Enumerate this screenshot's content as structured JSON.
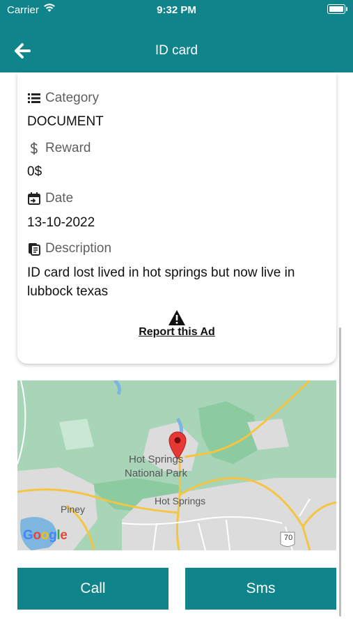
{
  "status": {
    "carrier": "Carrier",
    "time": "9:32 PM"
  },
  "header": {
    "title": "ID card",
    "back_icon": "arrow-left-icon"
  },
  "details": {
    "category": {
      "label": "Category",
      "value": "DOCUMENT",
      "icon": "list-icon"
    },
    "reward": {
      "label": "Reward",
      "value": "0$",
      "icon": "dollar-icon"
    },
    "date": {
      "label": "Date",
      "value": "13-10-2022",
      "icon": "calendar-icon"
    },
    "description": {
      "label": "Description",
      "value": "ID card lost lived in hot springs but now live in lubbock texas",
      "icon": "notes-icon"
    }
  },
  "report": {
    "label": "Report this Ad",
    "icon": "warning-icon"
  },
  "map": {
    "places": [
      "Hot Springs",
      "National Park",
      "Hot Springs",
      "Piney"
    ],
    "shield": "70",
    "attribution": "Google"
  },
  "actions": {
    "call": "Call",
    "sms": "Sms"
  },
  "colors": {
    "accent": "#0f848a",
    "pin": "#e53935"
  }
}
